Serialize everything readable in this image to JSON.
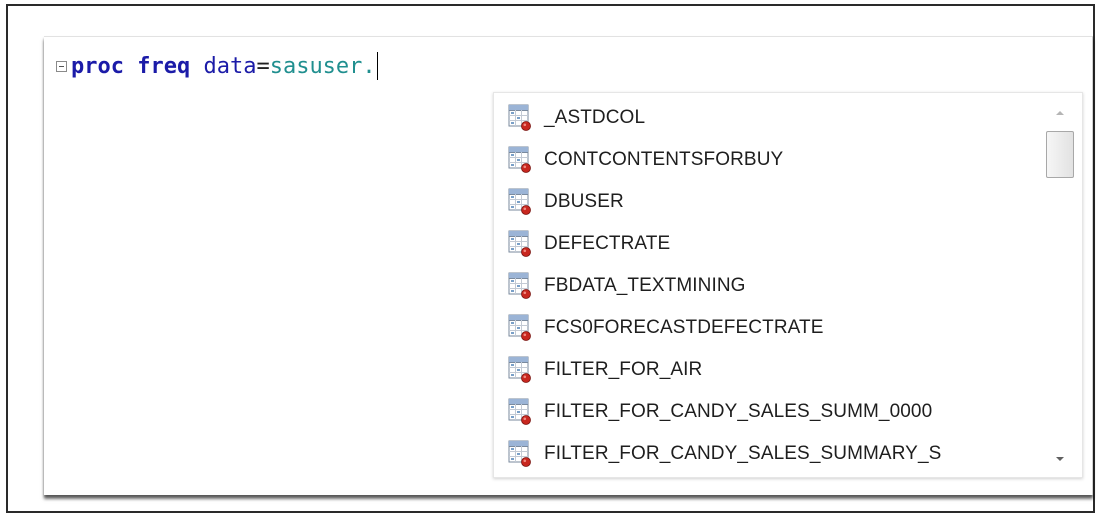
{
  "editor": {
    "code": {
      "keyword": "proc",
      "procedure": "freq",
      "option": "data",
      "equals": "=",
      "library": "sasuser."
    }
  },
  "autocomplete": {
    "icon": "sas-dataset-table-icon",
    "items": [
      "_ASTDCOL",
      "CONTCONTENTSFORBUY",
      "DBUSER",
      "DEFECTRATE",
      "FBDATA_TEXTMINING",
      "FCS0FORECASTDEFECTRATE",
      "FILTER_FOR_AIR",
      "FILTER_FOR_CANDY_SALES_SUMM_0000",
      "FILTER_FOR_CANDY_SALES_SUMMARY_S"
    ]
  },
  "colors": {
    "keyword": "#1b1ba8",
    "library": "#208f8f"
  }
}
